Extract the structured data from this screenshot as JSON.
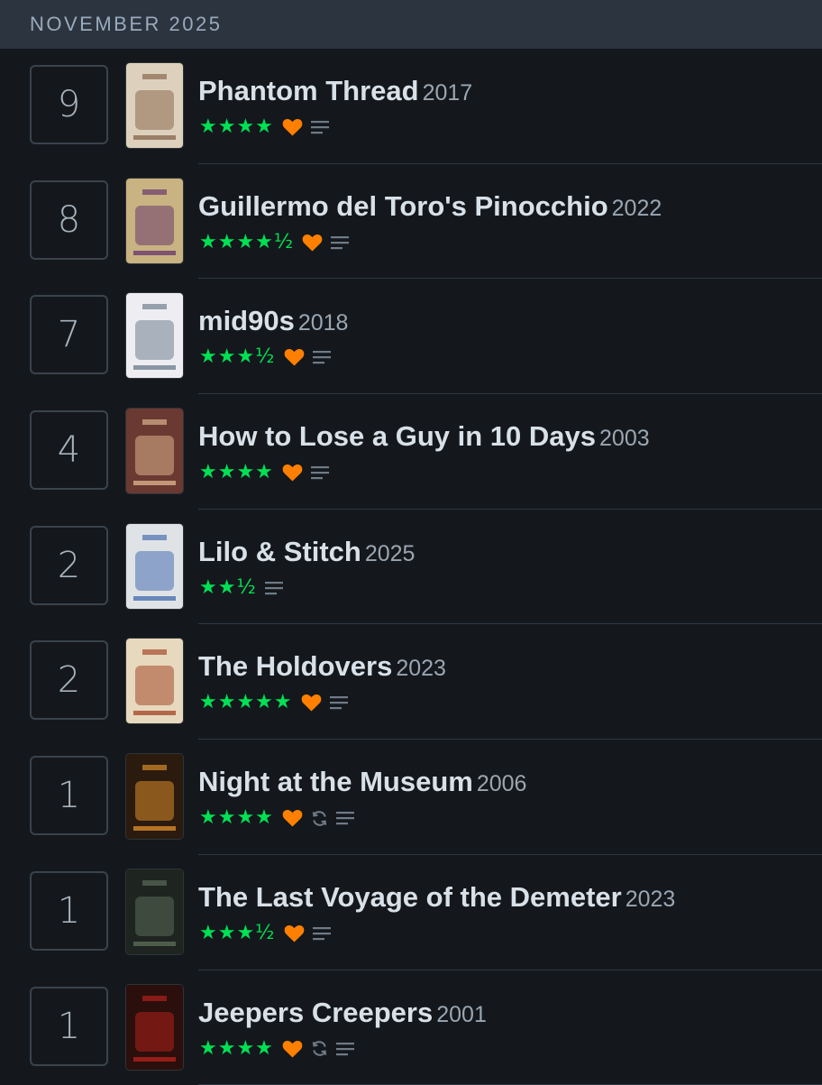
{
  "month": "NOVEMBER 2025",
  "entries": [
    {
      "day": "9",
      "title": "Phantom Thread",
      "year": "2017",
      "stars": "★★★★",
      "liked": true,
      "rewatch": false,
      "review": true,
      "poster": {
        "bg": "#ddd1bd",
        "accent": "#8a6a50"
      }
    },
    {
      "day": "8",
      "title": "Guillermo del Toro's Pinocchio",
      "year": "2022",
      "stars": "★★★★½",
      "liked": true,
      "rewatch": false,
      "review": true,
      "poster": {
        "bg": "#c9b382",
        "accent": "#6a3a6e"
      }
    },
    {
      "day": "7",
      "title": "mid90s",
      "year": "2018",
      "stars": "★★★½",
      "liked": true,
      "rewatch": false,
      "review": true,
      "poster": {
        "bg": "#eeeef2",
        "accent": "#6f7f8f"
      }
    },
    {
      "day": "4",
      "title": "How to Lose a Guy in 10 Days",
      "year": "2003",
      "stars": "★★★★",
      "liked": true,
      "rewatch": false,
      "review": true,
      "poster": {
        "bg": "#6a3a32",
        "accent": "#d9b08a"
      }
    },
    {
      "day": "2",
      "title": "Lilo & Stitch",
      "year": "2025",
      "stars": "★★½",
      "liked": false,
      "rewatch": false,
      "review": true,
      "poster": {
        "bg": "#dfe3e6",
        "accent": "#4a6fb0"
      }
    },
    {
      "day": "2",
      "title": "The Holdovers",
      "year": "2023",
      "stars": "★★★★★",
      "liked": true,
      "rewatch": false,
      "review": true,
      "poster": {
        "bg": "#e7d9bd",
        "accent": "#a64a2e"
      }
    },
    {
      "day": "1",
      "title": "Night at the Museum",
      "year": "2006",
      "stars": "★★★★",
      "liked": true,
      "rewatch": true,
      "review": true,
      "poster": {
        "bg": "#2a1b0e",
        "accent": "#d98a2a"
      }
    },
    {
      "day": "1",
      "title": "The Last Voyage of the Demeter",
      "year": "2023",
      "stars": "★★★½",
      "liked": true,
      "rewatch": false,
      "review": true,
      "poster": {
        "bg": "#1e2420",
        "accent": "#5a6a58"
      }
    },
    {
      "day": "1",
      "title": "Jeepers Creepers",
      "year": "2001",
      "stars": "★★★★",
      "liked": true,
      "rewatch": true,
      "review": true,
      "poster": {
        "bg": "#2a0f0c",
        "accent": "#b0201c"
      }
    }
  ],
  "colors": {
    "star": "#00e054",
    "heart": "#ff8000",
    "icon": "#6f7b87",
    "background": "#14181c",
    "header": "#2c3440"
  },
  "icons": {
    "liked": "heart-icon",
    "rewatch": "rewatch-icon",
    "review": "review-lines-icon"
  }
}
